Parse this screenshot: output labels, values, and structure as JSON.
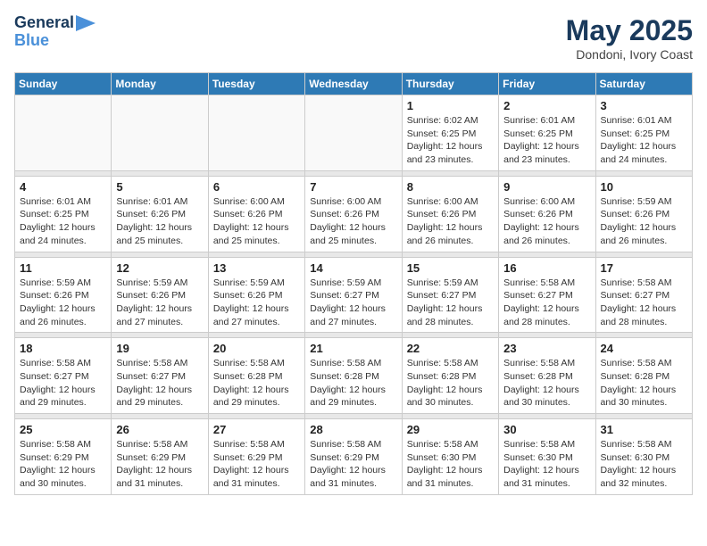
{
  "header": {
    "logo_line1": "General",
    "logo_line2": "Blue",
    "month": "May 2025",
    "location": "Dondoni, Ivory Coast"
  },
  "days_of_week": [
    "Sunday",
    "Monday",
    "Tuesday",
    "Wednesday",
    "Thursday",
    "Friday",
    "Saturday"
  ],
  "weeks": [
    [
      {
        "day": "",
        "info": ""
      },
      {
        "day": "",
        "info": ""
      },
      {
        "day": "",
        "info": ""
      },
      {
        "day": "",
        "info": ""
      },
      {
        "day": "1",
        "info": "Sunrise: 6:02 AM\nSunset: 6:25 PM\nDaylight: 12 hours\nand 23 minutes."
      },
      {
        "day": "2",
        "info": "Sunrise: 6:01 AM\nSunset: 6:25 PM\nDaylight: 12 hours\nand 23 minutes."
      },
      {
        "day": "3",
        "info": "Sunrise: 6:01 AM\nSunset: 6:25 PM\nDaylight: 12 hours\nand 24 minutes."
      }
    ],
    [
      {
        "day": "4",
        "info": "Sunrise: 6:01 AM\nSunset: 6:25 PM\nDaylight: 12 hours\nand 24 minutes."
      },
      {
        "day": "5",
        "info": "Sunrise: 6:01 AM\nSunset: 6:26 PM\nDaylight: 12 hours\nand 25 minutes."
      },
      {
        "day": "6",
        "info": "Sunrise: 6:00 AM\nSunset: 6:26 PM\nDaylight: 12 hours\nand 25 minutes."
      },
      {
        "day": "7",
        "info": "Sunrise: 6:00 AM\nSunset: 6:26 PM\nDaylight: 12 hours\nand 25 minutes."
      },
      {
        "day": "8",
        "info": "Sunrise: 6:00 AM\nSunset: 6:26 PM\nDaylight: 12 hours\nand 26 minutes."
      },
      {
        "day": "9",
        "info": "Sunrise: 6:00 AM\nSunset: 6:26 PM\nDaylight: 12 hours\nand 26 minutes."
      },
      {
        "day": "10",
        "info": "Sunrise: 5:59 AM\nSunset: 6:26 PM\nDaylight: 12 hours\nand 26 minutes."
      }
    ],
    [
      {
        "day": "11",
        "info": "Sunrise: 5:59 AM\nSunset: 6:26 PM\nDaylight: 12 hours\nand 26 minutes."
      },
      {
        "day": "12",
        "info": "Sunrise: 5:59 AM\nSunset: 6:26 PM\nDaylight: 12 hours\nand 27 minutes."
      },
      {
        "day": "13",
        "info": "Sunrise: 5:59 AM\nSunset: 6:26 PM\nDaylight: 12 hours\nand 27 minutes."
      },
      {
        "day": "14",
        "info": "Sunrise: 5:59 AM\nSunset: 6:27 PM\nDaylight: 12 hours\nand 27 minutes."
      },
      {
        "day": "15",
        "info": "Sunrise: 5:59 AM\nSunset: 6:27 PM\nDaylight: 12 hours\nand 28 minutes."
      },
      {
        "day": "16",
        "info": "Sunrise: 5:58 AM\nSunset: 6:27 PM\nDaylight: 12 hours\nand 28 minutes."
      },
      {
        "day": "17",
        "info": "Sunrise: 5:58 AM\nSunset: 6:27 PM\nDaylight: 12 hours\nand 28 minutes."
      }
    ],
    [
      {
        "day": "18",
        "info": "Sunrise: 5:58 AM\nSunset: 6:27 PM\nDaylight: 12 hours\nand 29 minutes."
      },
      {
        "day": "19",
        "info": "Sunrise: 5:58 AM\nSunset: 6:27 PM\nDaylight: 12 hours\nand 29 minutes."
      },
      {
        "day": "20",
        "info": "Sunrise: 5:58 AM\nSunset: 6:28 PM\nDaylight: 12 hours\nand 29 minutes."
      },
      {
        "day": "21",
        "info": "Sunrise: 5:58 AM\nSunset: 6:28 PM\nDaylight: 12 hours\nand 29 minutes."
      },
      {
        "day": "22",
        "info": "Sunrise: 5:58 AM\nSunset: 6:28 PM\nDaylight: 12 hours\nand 30 minutes."
      },
      {
        "day": "23",
        "info": "Sunrise: 5:58 AM\nSunset: 6:28 PM\nDaylight: 12 hours\nand 30 minutes."
      },
      {
        "day": "24",
        "info": "Sunrise: 5:58 AM\nSunset: 6:28 PM\nDaylight: 12 hours\nand 30 minutes."
      }
    ],
    [
      {
        "day": "25",
        "info": "Sunrise: 5:58 AM\nSunset: 6:29 PM\nDaylight: 12 hours\nand 30 minutes."
      },
      {
        "day": "26",
        "info": "Sunrise: 5:58 AM\nSunset: 6:29 PM\nDaylight: 12 hours\nand 31 minutes."
      },
      {
        "day": "27",
        "info": "Sunrise: 5:58 AM\nSunset: 6:29 PM\nDaylight: 12 hours\nand 31 minutes."
      },
      {
        "day": "28",
        "info": "Sunrise: 5:58 AM\nSunset: 6:29 PM\nDaylight: 12 hours\nand 31 minutes."
      },
      {
        "day": "29",
        "info": "Sunrise: 5:58 AM\nSunset: 6:30 PM\nDaylight: 12 hours\nand 31 minutes."
      },
      {
        "day": "30",
        "info": "Sunrise: 5:58 AM\nSunset: 6:30 PM\nDaylight: 12 hours\nand 31 minutes."
      },
      {
        "day": "31",
        "info": "Sunrise: 5:58 AM\nSunset: 6:30 PM\nDaylight: 12 hours\nand 32 minutes."
      }
    ]
  ]
}
